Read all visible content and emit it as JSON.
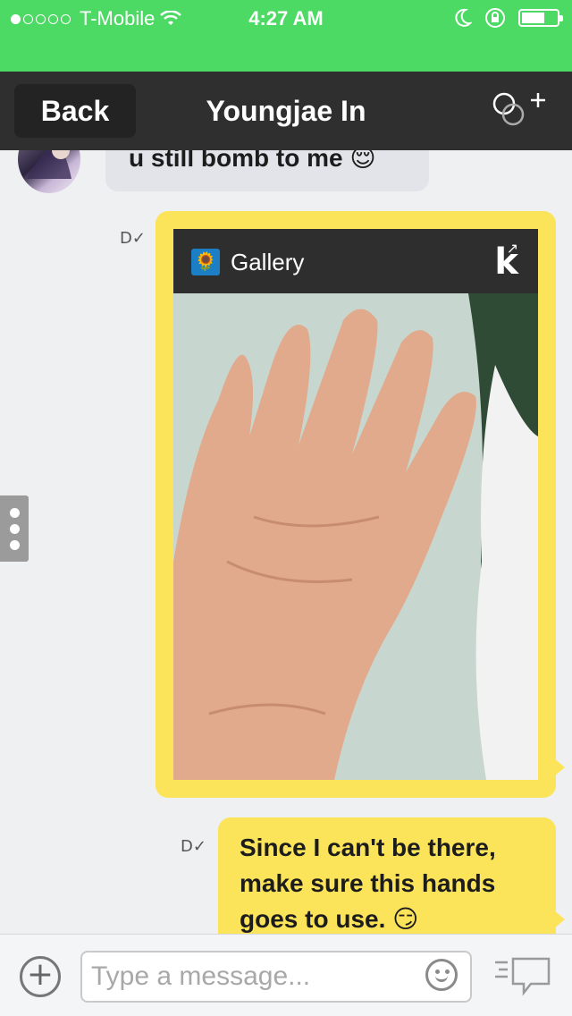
{
  "status_bar": {
    "carrier": "T-Mobile",
    "time": "4:27 AM",
    "signal_bars_filled": 1,
    "signal_bars_total": 5,
    "battery_level": 0.65
  },
  "nav": {
    "back_label": "Back",
    "title": "Youngjae In",
    "add_friend_icon": "add-friend-icon"
  },
  "messages": [
    {
      "type": "received",
      "text": "u still bomb to me 😌"
    },
    {
      "type": "sent-image",
      "read_marker": "D",
      "card_label": "Gallery",
      "card_icon": "🌻",
      "brand": "k"
    },
    {
      "type": "sent",
      "read_marker": "D",
      "lines": [
        "Since I can't be there,",
        "make sure this hands",
        "goes to use. 😏"
      ]
    }
  ],
  "input": {
    "placeholder": "Type a message..."
  },
  "colors": {
    "status_green": "#4cd964",
    "nav_dark": "#2f2f2f",
    "sent_bubble": "#fbe35a",
    "received_bubble": "#e3e4e9"
  }
}
